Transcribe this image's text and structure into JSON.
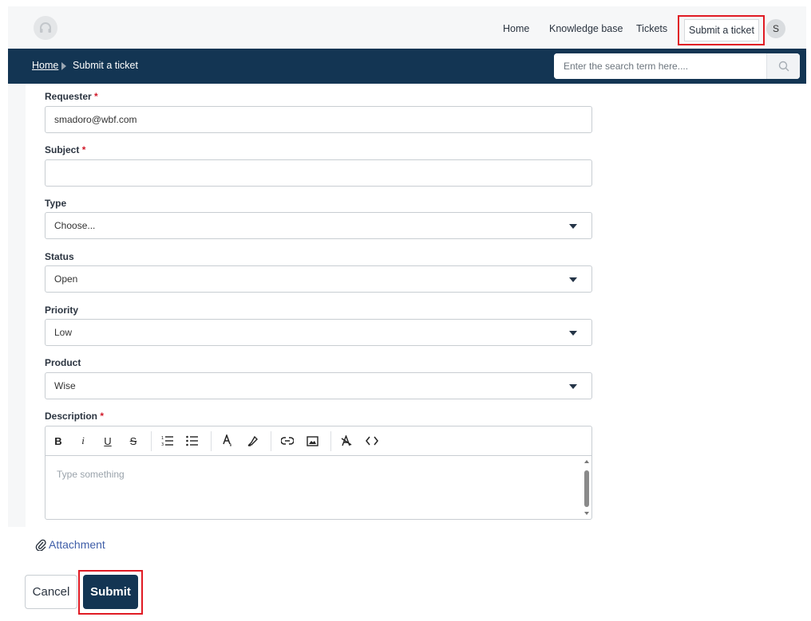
{
  "header": {
    "logo_icon": "headset-logo-icon",
    "nav": [
      {
        "label": "Home"
      },
      {
        "label": "Knowledge base"
      },
      {
        "label": "Tickets"
      },
      {
        "label": "Submit a ticket"
      }
    ],
    "avatar_initial": "S"
  },
  "subheader": {
    "breadcrumb": {
      "home": "Home",
      "current": "Submit a ticket"
    },
    "search": {
      "placeholder": "Enter the search term here....",
      "icon": "search-icon"
    }
  },
  "form": {
    "requester": {
      "label": "Requester",
      "required_mark": "*",
      "value": "smadoro@wbf.com"
    },
    "subject": {
      "label": "Subject",
      "required_mark": "*",
      "value": ""
    },
    "type": {
      "label": "Type",
      "value": "Choose..."
    },
    "status": {
      "label": "Status",
      "value": "Open"
    },
    "priority": {
      "label": "Priority",
      "value": "Low"
    },
    "product": {
      "label": "Product",
      "value": "Wise"
    },
    "description": {
      "label": "Description",
      "required_mark": "*",
      "placeholder": "Type something",
      "toolbar": {
        "bold": "B",
        "italic": "i",
        "underline": "U",
        "strike": "S"
      }
    }
  },
  "attachment": {
    "label": "Attachment",
    "icon": "paperclip-icon"
  },
  "actions": {
    "cancel": "Cancel",
    "submit": "Submit"
  },
  "colors": {
    "navy": "#133553",
    "highlight": "#e01b24",
    "link": "#3f5ea8",
    "required": "#d11a2a"
  }
}
